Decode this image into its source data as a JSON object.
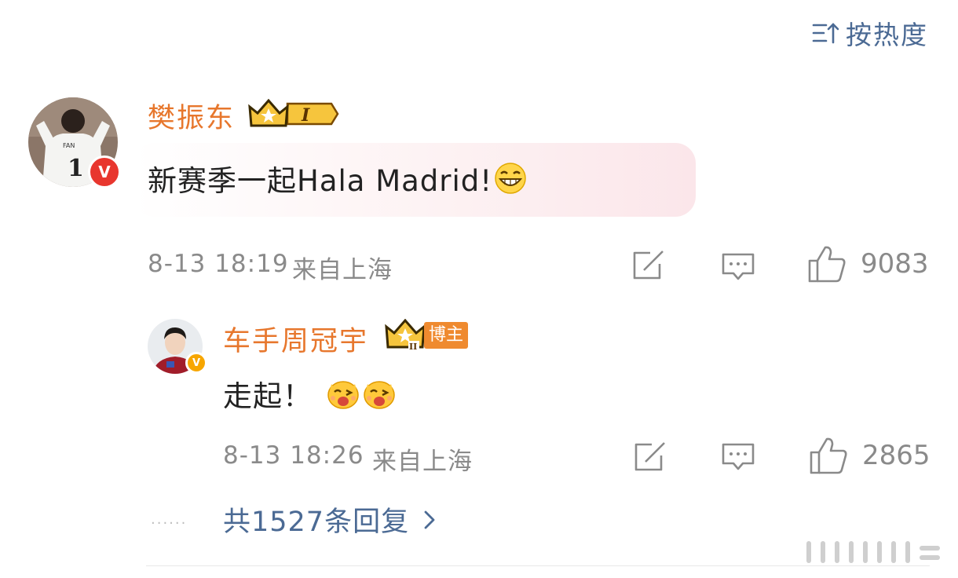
{
  "sort": {
    "label": "按热度",
    "icon": "sort-icon"
  },
  "comment": {
    "author": "樊振东",
    "crown_level": "I",
    "text": "新赛季一起Hala Madrid!",
    "jersey": {
      "name": "FAN",
      "number": "1"
    },
    "badge": "V",
    "time": "8-13 18:19",
    "location": "来自上海",
    "likes": "9083"
  },
  "reply": {
    "author": "车手周冠宇",
    "crown_level": "II",
    "tag": "博主",
    "text": "走起！",
    "badge": "V",
    "time": "8-13 18:26",
    "location": "来自上海",
    "likes": "2865"
  },
  "more_replies": {
    "label": "共1527条回复",
    "dots": "······"
  },
  "colors": {
    "name": "#e7772d",
    "link": "#4b6a94",
    "meta": "#8a8a8a",
    "verified_red": "#e8362e",
    "verified_orange": "#f7a600"
  }
}
